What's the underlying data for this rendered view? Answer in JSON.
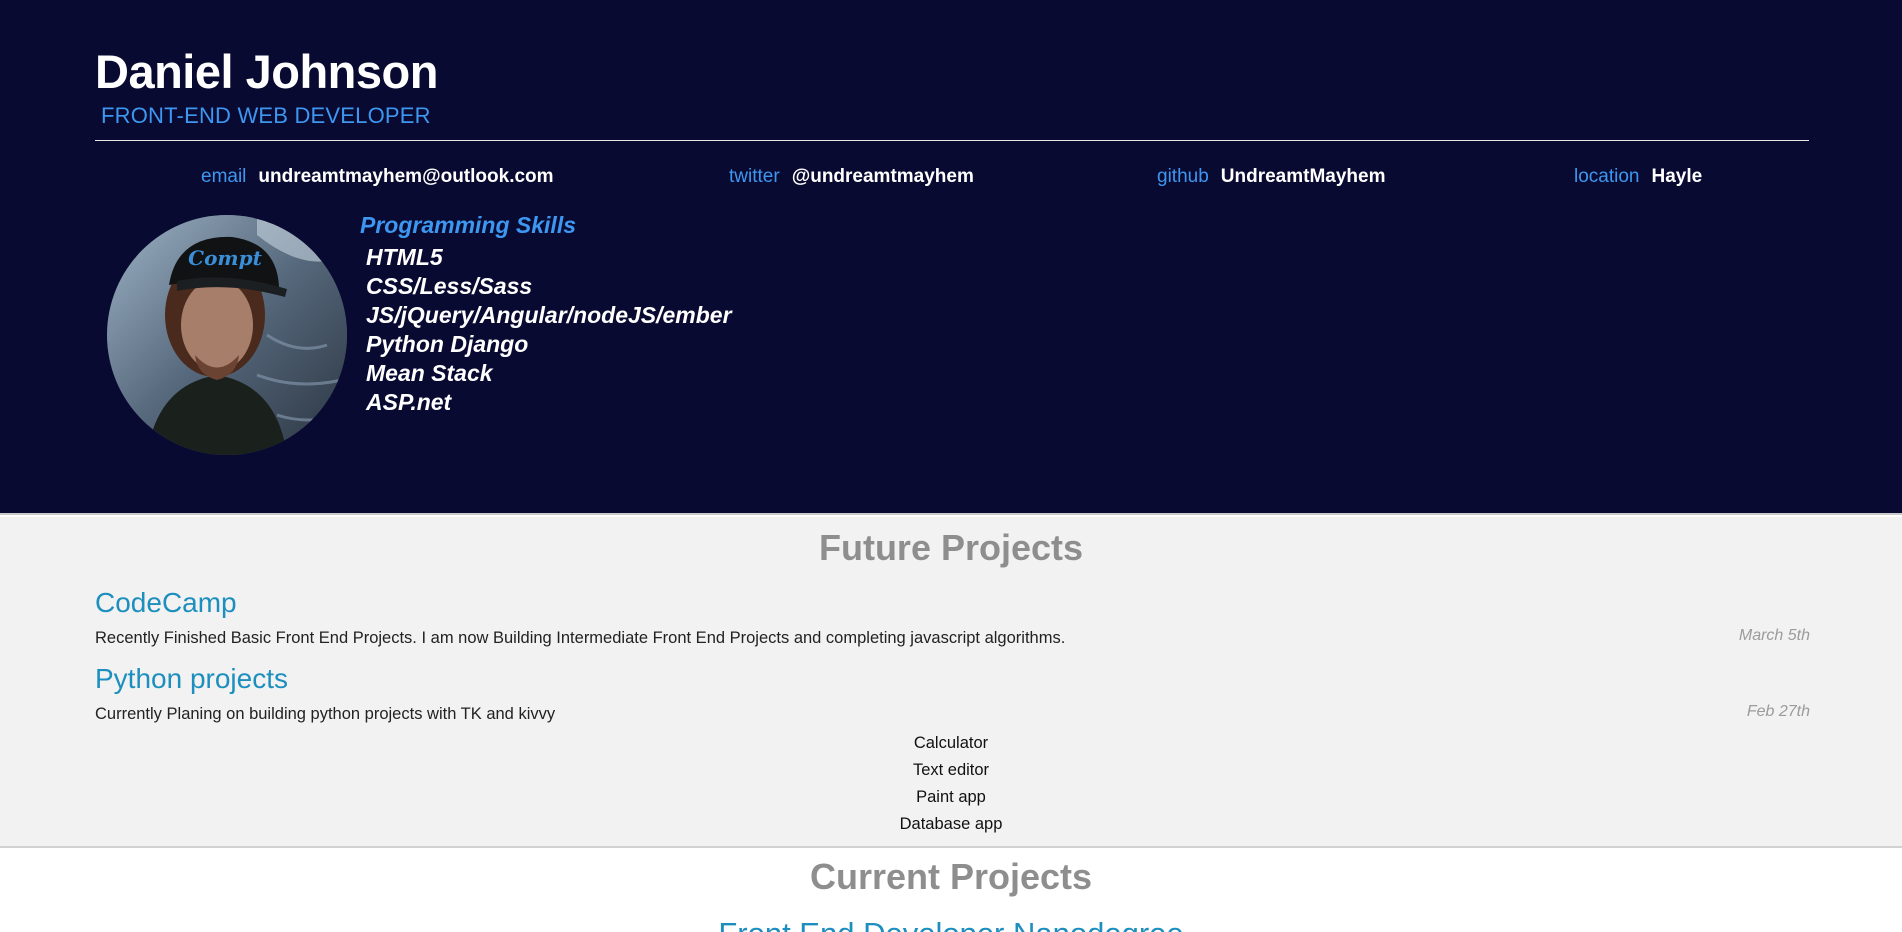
{
  "header": {
    "name": "Daniel Johnson",
    "role": "FRONT-END WEB DEVELOPER",
    "contacts": [
      {
        "key": "email",
        "value": "undreamtmayhem@outlook.com"
      },
      {
        "key": "twitter",
        "value": "@undreamtmayhem"
      },
      {
        "key": "github",
        "value": "UndreamtMayhem"
      },
      {
        "key": "location",
        "value": "Hayle"
      }
    ],
    "skills_title": "Programming Skills",
    "skills": [
      "HTML5",
      "CSS/Less/Sass",
      "JS/jQuery/Angular/nodeJS/ember",
      "Python Django",
      "Mean Stack",
      "ASP.net"
    ],
    "avatar_cap_text": "Compt"
  },
  "future": {
    "title": "Future Projects",
    "projects": [
      {
        "title": "CodeCamp",
        "description": "Recently Finished Basic Front End Projects. I am now Building Intermediate Front End Projects and completing javascript algorithms.",
        "date": "March 5th"
      },
      {
        "title": "Python projects",
        "description": "Currently Planing on building python projects with TK and kivvy",
        "date": "Feb 27th"
      }
    ],
    "subitems": [
      "Calculator",
      "Text editor",
      "Paint app",
      "Database app"
    ]
  },
  "current": {
    "title": "Current Projects",
    "first_project": "Front End Developer Nanodegree"
  },
  "colors": {
    "header_bg": "#090a31",
    "accent": "#3d97f1",
    "project_title": "#1d8fbe",
    "section_bg": "#f2f2f2"
  }
}
